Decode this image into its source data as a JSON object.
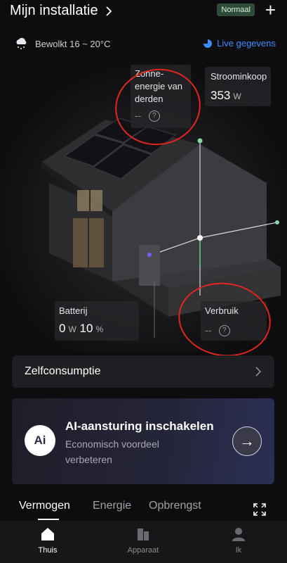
{
  "header": {
    "title": "Mijn installatie",
    "badge": "Normaal"
  },
  "weather": {
    "text": "Bewolkt 16 ~ 20°C",
    "live_label": "Live gegevens"
  },
  "cards": {
    "third_party": {
      "label": "Zonne-energie van derden",
      "value": "--"
    },
    "grid_import": {
      "label": "Stroominkoop",
      "value": "353",
      "unit": "W"
    },
    "battery": {
      "label": "Batterij",
      "power": "0",
      "power_unit": "W",
      "soc": "10",
      "soc_unit": "%"
    },
    "consumption": {
      "label": "Verbruik",
      "value": "--"
    }
  },
  "self_consumption": {
    "label": "Zelfconsumptie"
  },
  "ai": {
    "logo": "Ai",
    "title": "AI-aansturing inschakelen",
    "subtitle": "Economisch voordeel verbeteren"
  },
  "tabs": [
    {
      "label": "Vermogen"
    },
    {
      "label": "Energie"
    },
    {
      "label": "Opbrengst"
    }
  ],
  "nav": [
    {
      "label": "Thuis"
    },
    {
      "label": "Apparaat"
    },
    {
      "label": "Ik"
    }
  ],
  "colors": {
    "accent": "#3d8cff",
    "annotation": "#e0261f",
    "badge_bg": "#2f4c3a"
  }
}
